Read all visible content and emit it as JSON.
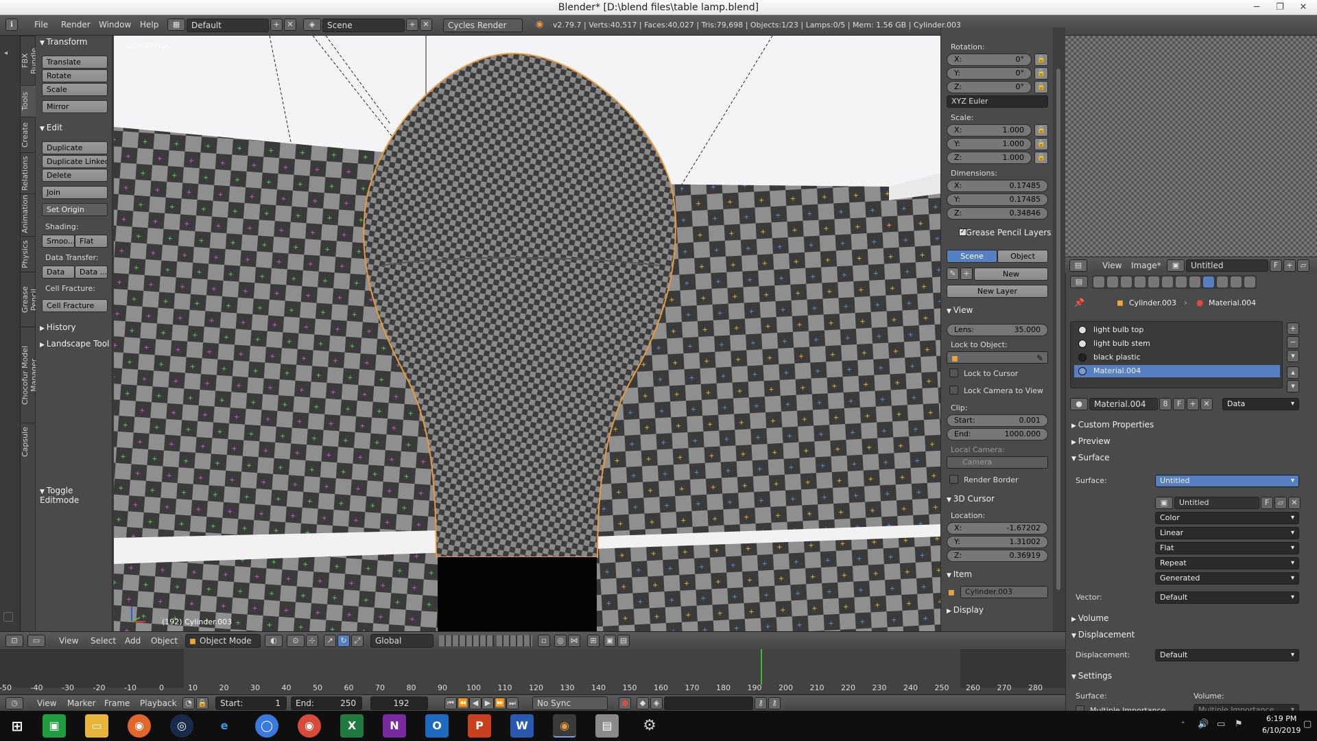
{
  "window": {
    "title": "Blender* [D:\\blend files\\table lamp.blend]"
  },
  "infobar": {
    "menus": [
      "File",
      "Render",
      "Window",
      "Help"
    ],
    "screen_layout": "Default",
    "scene": "Scene",
    "render_engine": "Cycles Render",
    "stats": "v2.79.7 | Verts:40,517 | Faces:40,027 | Tris:79,698 | Objects:1/23 | Lamps:0/5 | Mem: 1.56 GB | Cylinder.003"
  },
  "tool_tabs": [
    "FBX Bundle",
    "Tools",
    "Create",
    "Relations",
    "Animation",
    "Physics",
    "Grease Pencil",
    "Chocofur Model Manager",
    "Capsule"
  ],
  "tool_shelf": {
    "transform": {
      "header": "Transform",
      "buttons": [
        "Translate",
        "Rotate",
        "Scale",
        "Mirror"
      ]
    },
    "edit": {
      "header": "Edit",
      "buttons": [
        "Duplicate",
        "Duplicate Linked",
        "Delete",
        "Join"
      ],
      "set_origin": "Set Origin"
    },
    "shading": {
      "label": "Shading:",
      "smooth": "Smoo...",
      "flat": "Flat"
    },
    "data_transfer": {
      "label": "Data Transfer:",
      "data": "Data",
      "data_layout": "Data ..."
    },
    "cell_fracture": {
      "label": "Cell Fracture:",
      "button": "Cell Fracture"
    },
    "history": "History",
    "landscape": "Landscape Tool",
    "toggle_editmode": "Toggle Editmode"
  },
  "viewport": {
    "view_name": "User Persp",
    "object_label": "(192) Cylinder.003"
  },
  "n_panel": {
    "rotation": {
      "label": "Rotation:",
      "x": "0°",
      "y": "0°",
      "z": "0°",
      "mode": "XYZ Euler"
    },
    "scale": {
      "label": "Scale:",
      "x": "1.000",
      "y": "1.000",
      "z": "1.000"
    },
    "dimensions": {
      "label": "Dimensions:",
      "x": "0.17485",
      "y": "0.17485",
      "z": "0.34846"
    },
    "grease_pencil": {
      "header": "Grease Pencil Layers",
      "scene": "Scene",
      "object": "Object",
      "new": "New",
      "new_layer": "New Layer"
    },
    "view": {
      "header": "View",
      "lens_label": "Lens:",
      "lens": "35.000",
      "lock_object_label": "Lock to Object:",
      "lock_cursor": "Lock to Cursor",
      "lock_camera": "Lock Camera to View",
      "clip_label": "Clip:",
      "start_label": "Start:",
      "start": "0.001",
      "end_label": "End:",
      "end": "1000.000",
      "local_camera_label": "Local Camera:",
      "camera": "Camera",
      "render_border": "Render Border"
    },
    "cursor": {
      "header": "3D Cursor",
      "location_label": "Location:",
      "x": "-1.67202",
      "y": "1.31002",
      "z": "0.36919"
    },
    "item": {
      "header": "Item",
      "name": "Cylinder.003"
    },
    "display": {
      "header": "Display"
    },
    "axis_labels": {
      "x": "X:",
      "y": "Y:",
      "z": "Z:"
    }
  },
  "image_editor": {
    "menus": [
      "View",
      "Image*"
    ],
    "image_name": "Untitled",
    "fake_user": "F"
  },
  "properties": {
    "breadcrumb": {
      "object": "Cylinder.003",
      "material": "Material.004"
    },
    "material_slots": [
      "light bulb top",
      "light bulb stem",
      "black plastic",
      "Material.004"
    ],
    "selected_slot": 3,
    "material_name": "Material.004",
    "users": "8",
    "fake_user": "F",
    "link": "Data",
    "panels": {
      "custom_properties": "Custom Properties",
      "preview": "Preview",
      "surface": "Surface",
      "volume": "Volume",
      "displacement": "Displacement",
      "settings": "Settings"
    },
    "surface": {
      "label": "Surface:",
      "value": "Untitled",
      "image": "Untitled",
      "color": "Color",
      "interpolation": "Linear",
      "projection": "Flat",
      "extension": "Repeat",
      "source": "Generated",
      "vector_label": "Vector:",
      "vector": "Default"
    },
    "displacement": {
      "label": "Displacement:",
      "value": "Default"
    },
    "settings": {
      "surface_label": "Surface:",
      "volume_label": "Volume:",
      "mis": "Multiple Importance",
      "mis2": "Multiple Importance"
    }
  },
  "viewport_header": {
    "menus": [
      "View",
      "Select",
      "Add",
      "Object"
    ],
    "mode": "Object Mode",
    "orientation": "Global"
  },
  "timeline": {
    "ticks": [
      "-50",
      "-40",
      "-30",
      "-20",
      "-10",
      "0",
      "10",
      "20",
      "30",
      "40",
      "50",
      "60",
      "70",
      "80",
      "90",
      "100",
      "110",
      "120",
      "130",
      "140",
      "150",
      "160",
      "170",
      "180",
      "190",
      "200",
      "210",
      "220",
      "230",
      "240",
      "250",
      "260",
      "270",
      "280"
    ],
    "current_frame": 192,
    "menus": [
      "View",
      "Marker",
      "Frame",
      "Playback"
    ],
    "start_label": "Start:",
    "start": "1",
    "end_label": "End:",
    "end": "250",
    "frame": "192",
    "sync": "No Sync"
  },
  "taskbar": {
    "apps": [
      "Start",
      "Store",
      "File Explorer",
      "Firefox",
      "Steam",
      "Internet Explorer",
      "Browser",
      "Chrome",
      "Excel",
      "OneNote",
      "Outlook",
      "PowerPoint",
      "Word",
      "Blender",
      "Remote Desktop",
      "Settings"
    ],
    "time": "6:19 PM",
    "date": "6/10/2019"
  },
  "colors": {
    "accent": "#5680c2",
    "selected_orange": "#e89a3c",
    "checker_dark": "#3a3a3a",
    "checker_light": "#8f8f8f"
  }
}
